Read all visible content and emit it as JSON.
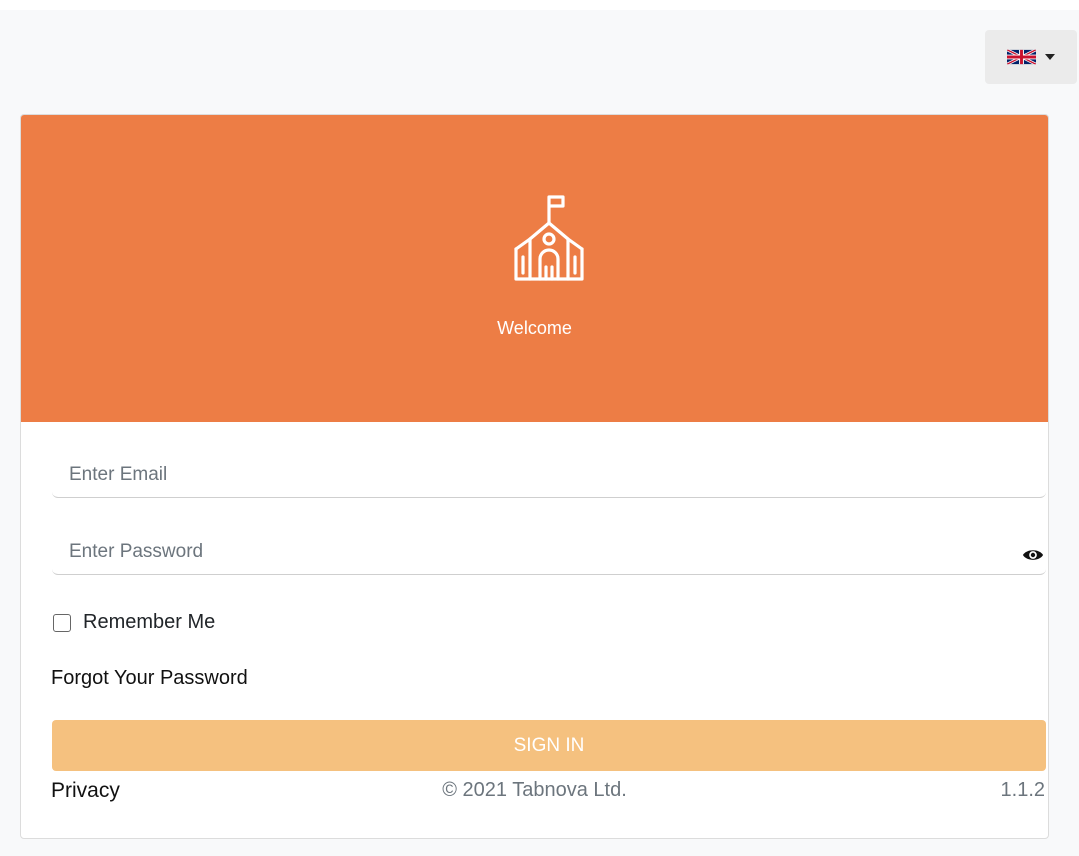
{
  "header": {
    "language": {
      "icon": "uk-flag-icon",
      "dropdown_icon": "caret-down-icon"
    }
  },
  "hero": {
    "icon": "school-icon",
    "welcome": "Welcome",
    "color": "#ed7d45"
  },
  "form": {
    "email": {
      "placeholder": "Enter Email",
      "value": ""
    },
    "password": {
      "placeholder": "Enter Password",
      "value": "",
      "toggle_icon": "eye-icon"
    },
    "remember_label": "Remember Me",
    "remember_checked": false,
    "forgot_label": "Forgot Your Password",
    "signin_label": "SIGN IN",
    "signin_color": "#f5c17f"
  },
  "footer": {
    "privacy": "Privacy",
    "copyright": "© 2021 Tabnova Ltd.",
    "version": "1.1.2"
  }
}
